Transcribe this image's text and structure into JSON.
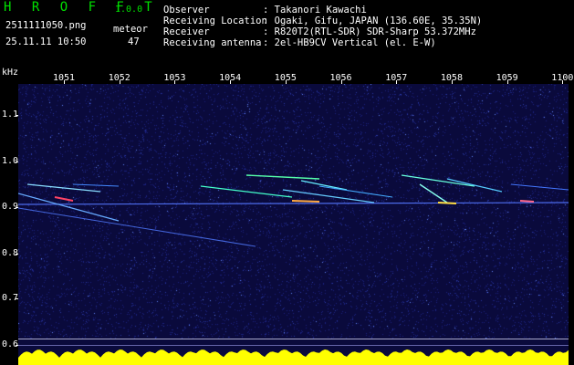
{
  "header": {
    "app_title": "H R O F F T",
    "version": "1.0.0",
    "filename": "2511111050.png",
    "datetime": "25.11.11 10:50",
    "meteor_label": "meteor",
    "meteor_count": "47",
    "observer_label": "Observer",
    "observer_value": ": Takanori Kawachi",
    "location_label": "Receiving Location",
    "location_value": ": Ogaki, Gifu, JAPAN (136.60E, 35.35N)",
    "receiver_label": "Receiver",
    "receiver_value": ": R820T2(RTL-SDR) SDR-Sharp 53.372MHz",
    "antenna_label": "Receiving antenna",
    "antenna_value": ": 2el-HB9CV Vertical (el. E-W)"
  },
  "axis": {
    "y_unit": "kHz",
    "y_ticks": [
      "1.1",
      "1.0",
      "0.9",
      "0.8",
      "0.7",
      "0.6"
    ],
    "x_ticks": [
      "1051",
      "1052",
      "1053",
      "1054",
      "1055",
      "1056",
      "1057",
      "1058",
      "1059",
      "1100"
    ]
  },
  "colors": {
    "background": "#000000",
    "plot_bg": "#0a0a3c",
    "title_green": "#00e000",
    "band_yellow": "#ffff00",
    "band_cyan": "#00c8ff"
  }
}
